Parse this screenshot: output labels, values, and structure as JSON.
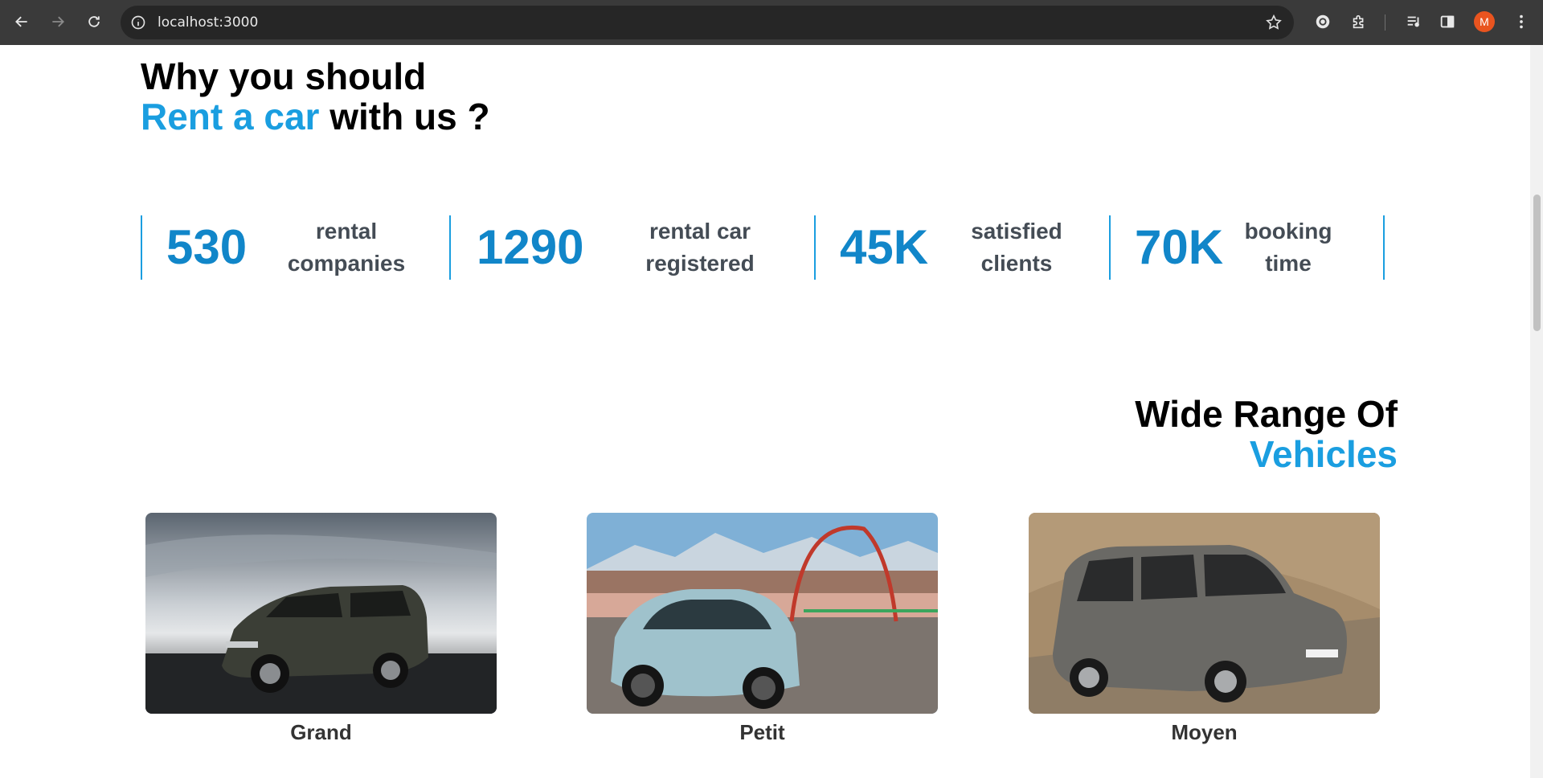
{
  "browser": {
    "url": "localhost:3000",
    "profile_initial": "M",
    "icons": {
      "back": "arrow-left-icon",
      "forward": "arrow-right-icon",
      "reload": "reload-icon",
      "site_info": "info-circle-icon",
      "bookmark": "star-icon",
      "extension": "puzzle-icon",
      "media": "media-queue-icon",
      "side_panel": "side-panel-icon",
      "menu": "kebab-menu-icon"
    }
  },
  "why_section": {
    "title_line1": "Why you should",
    "title_accent": "Rent a car",
    "title_rest": " with us ?",
    "stats": [
      {
        "value": "530",
        "label_line1": "rental",
        "label_line2": "companies"
      },
      {
        "value": "1290",
        "label_line1": "rental car",
        "label_line2": "registered"
      },
      {
        "value": "45K",
        "label_line1": "satisfied",
        "label_line2": "clients"
      },
      {
        "value": "70K",
        "label_line1": "booking",
        "label_line2": "time"
      }
    ]
  },
  "vehicles_section": {
    "title_line1": "Wide Range Of",
    "title_accent": "Vehicles",
    "cards": [
      {
        "label": "Grand",
        "image": "dark-suv-photo"
      },
      {
        "label": "Petit",
        "image": "light-blue-small-car-photo"
      },
      {
        "label": "Moyen",
        "image": "grey-minivan-photo"
      }
    ]
  },
  "colors": {
    "accent": "#1a9ee0",
    "stat_number": "#1186c9",
    "stat_label": "#444c55"
  }
}
